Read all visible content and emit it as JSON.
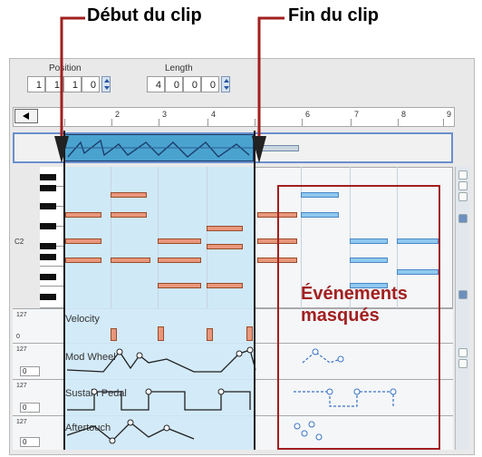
{
  "annotations": {
    "start_label": "Début du clip",
    "end_label": "Fin du clip",
    "hidden_label_line1": "Événements",
    "hidden_label_line2": "masqués"
  },
  "toolbar": {
    "position_label": "Position",
    "length_label": "Length",
    "position_fields": [
      "1",
      "1",
      "1",
      "0"
    ],
    "length_fields": [
      "4",
      "0",
      "0",
      "0"
    ]
  },
  "ruler": {
    "ticks": [
      "2",
      "3",
      "4",
      "6",
      "7",
      "8",
      "9"
    ]
  },
  "piano_roll": {
    "octave_label": "C2"
  },
  "lanes": [
    {
      "label": "Velocity",
      "max": "127",
      "min": "0"
    },
    {
      "label": "Mod Wheel",
      "max": "127",
      "field": "0"
    },
    {
      "label": "Sustain Pedal",
      "max": "127",
      "field": "0"
    },
    {
      "label": "Aftertouch",
      "max": "127",
      "field": "0"
    }
  ],
  "colors": {
    "clip_area": "#cfe9f7",
    "note_visible": "#e9977b",
    "note_hidden": "#8ec9f0",
    "annotation_red": "#a21f1f",
    "marker_red": "#a21f1f"
  }
}
